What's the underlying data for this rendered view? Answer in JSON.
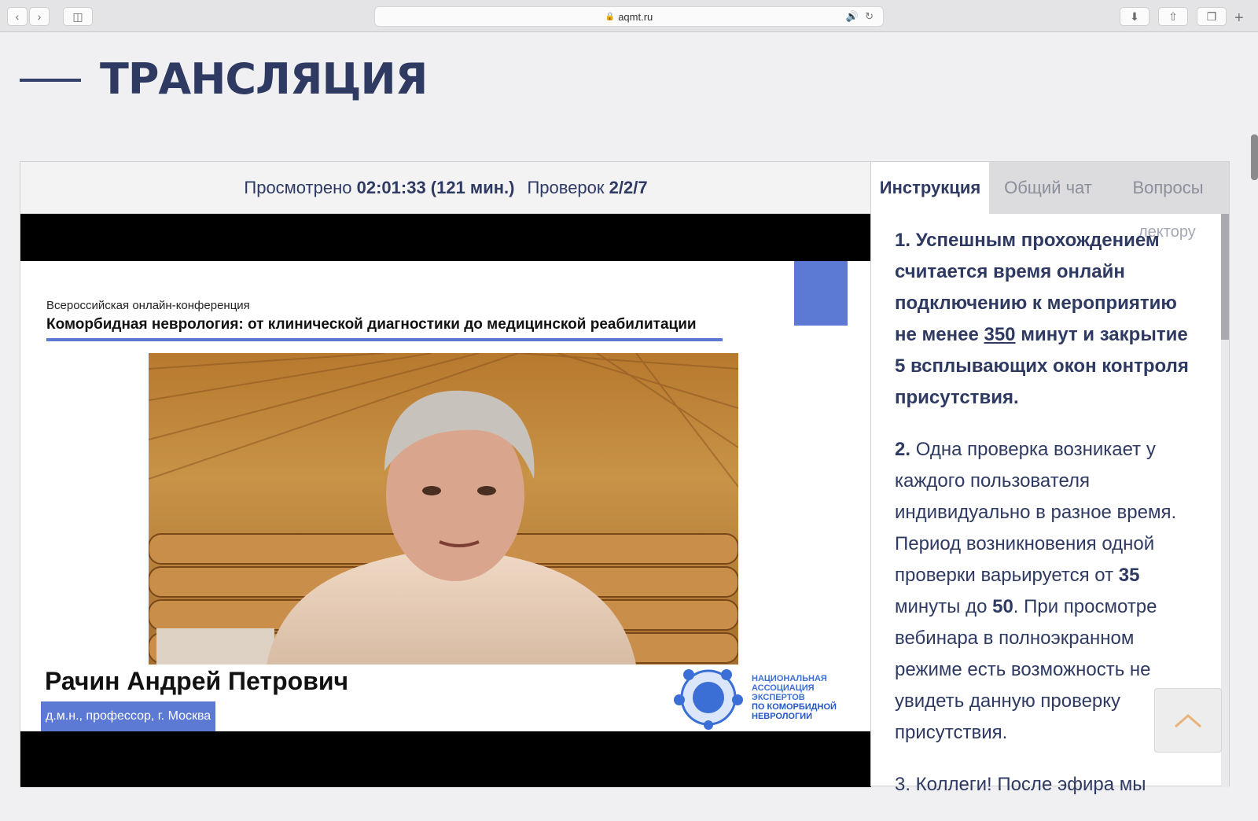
{
  "browser": {
    "url": "aqmt.ru",
    "icons": [
      "back-icon",
      "forward-icon",
      "sidebar-icon",
      "lock-icon",
      "sound-icon",
      "reload-icon",
      "download-icon",
      "share-icon",
      "tabs-icon",
      "new-tab-icon"
    ],
    "accent": "#5a7ed6"
  },
  "page": {
    "title": "ТРАНСЛЯЦИЯ",
    "title_color": "#2e3a62"
  },
  "stats": {
    "watched_label": "Просмотрено",
    "watched_value": "02:01:33 (121 мин.)",
    "checks_label": "Проверок",
    "checks_value": "2/2/7"
  },
  "slide": {
    "conference_type": "Всероссийская онлайн-конференция",
    "conference_title": "Коморбидная неврология: от клинической диагностики до медицинской реабилитации",
    "speaker_name": "Рачин Андрей Петрович",
    "speaker_role": "д.м.н., профессор, г. Москва",
    "logo_line1": "НАЦИОНАЛЬНАЯ",
    "logo_line2": "АССОЦИАЦИЯ",
    "logo_line3": "ЭКСПЕРТОВ",
    "logo_line4": "ПО КОМОРБИДНОЙ",
    "logo_line5": "НЕВРОЛОГИИ",
    "accent_color": "#5c7ad4"
  },
  "tabs": [
    {
      "label": "Инструкция",
      "active": true
    },
    {
      "label": "Общий чат",
      "active": false
    },
    {
      "label": "Вопросы",
      "active": false
    }
  ],
  "instruction": {
    "ghost": "лектору",
    "p1_num": "1.",
    "p1_a": "Успешным прохождением считается время онлайн подключению к мероприятию не менее",
    "p1_minutes": "350",
    "p1_b": "минут и закрытие 5 всплывающих окон контроля присутствия.",
    "p2_num": "2.",
    "p2_a": "Одна проверка возникает у каждого пользователя индивидуально в разное время. Период возникновения одной проверки варьируется от",
    "p2_from": "35",
    "p2_mid": "минуты до",
    "p2_to": "50",
    "p2_b": ". При просмотре вебинара в полноэкранном режиме есть возможность не увидеть данную проверку присутствия.",
    "p3_start": "3. Коллеги! После эфира мы"
  }
}
